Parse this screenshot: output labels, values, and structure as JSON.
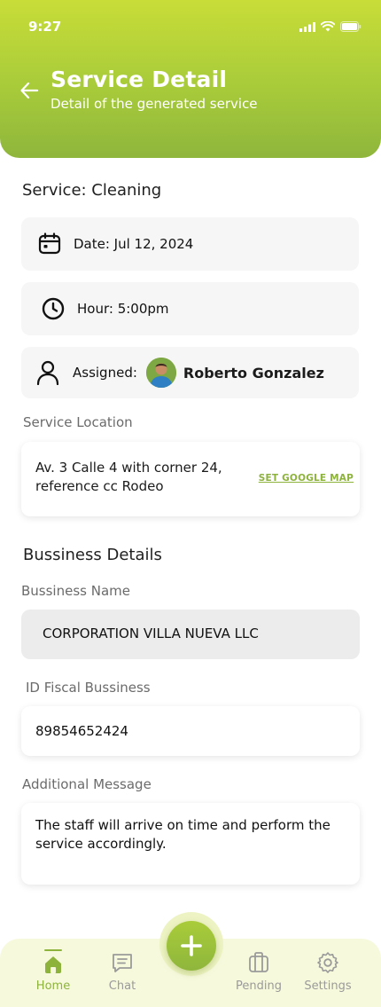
{
  "status": {
    "time": "9:27"
  },
  "header": {
    "title": "Service Detail",
    "subtitle": "Detail of the generated service"
  },
  "service": {
    "title": "Service: Cleaning",
    "date": "Date: Jul 12, 2024",
    "hour": "Hour: 5:00pm",
    "assigned_label": "Assigned:",
    "assignee": "Roberto Gonzalez"
  },
  "location": {
    "label": "Service Location",
    "address": "Av. 3 Calle 4 with corner 24, reference cc Rodeo",
    "map_link": "SET GOOGLE MAP"
  },
  "business": {
    "heading": "Bussiness Details",
    "name_label": "Bussiness Name",
    "name_value": "CORPORATION VILLA NUEVA LLC",
    "fiscal_label": "ID Fiscal Bussiness",
    "fiscal_value": "89854652424",
    "message_label": "Additional Message",
    "message_value": "The staff will arrive on time and perform the service accordingly."
  },
  "nav": {
    "items": [
      {
        "label": "Home",
        "icon": "home-icon",
        "active": true
      },
      {
        "label": "Chat",
        "icon": "chat-icon",
        "active": false
      },
      {
        "label": "Pending",
        "icon": "briefcase-icon",
        "active": false
      },
      {
        "label": "Settings",
        "icon": "gear-icon",
        "active": false
      }
    ],
    "fab_icon": "plus-icon"
  },
  "colors": {
    "accent": "#8db33c",
    "header_top": "#c8dd38",
    "header_bottom": "#8fb63c"
  }
}
